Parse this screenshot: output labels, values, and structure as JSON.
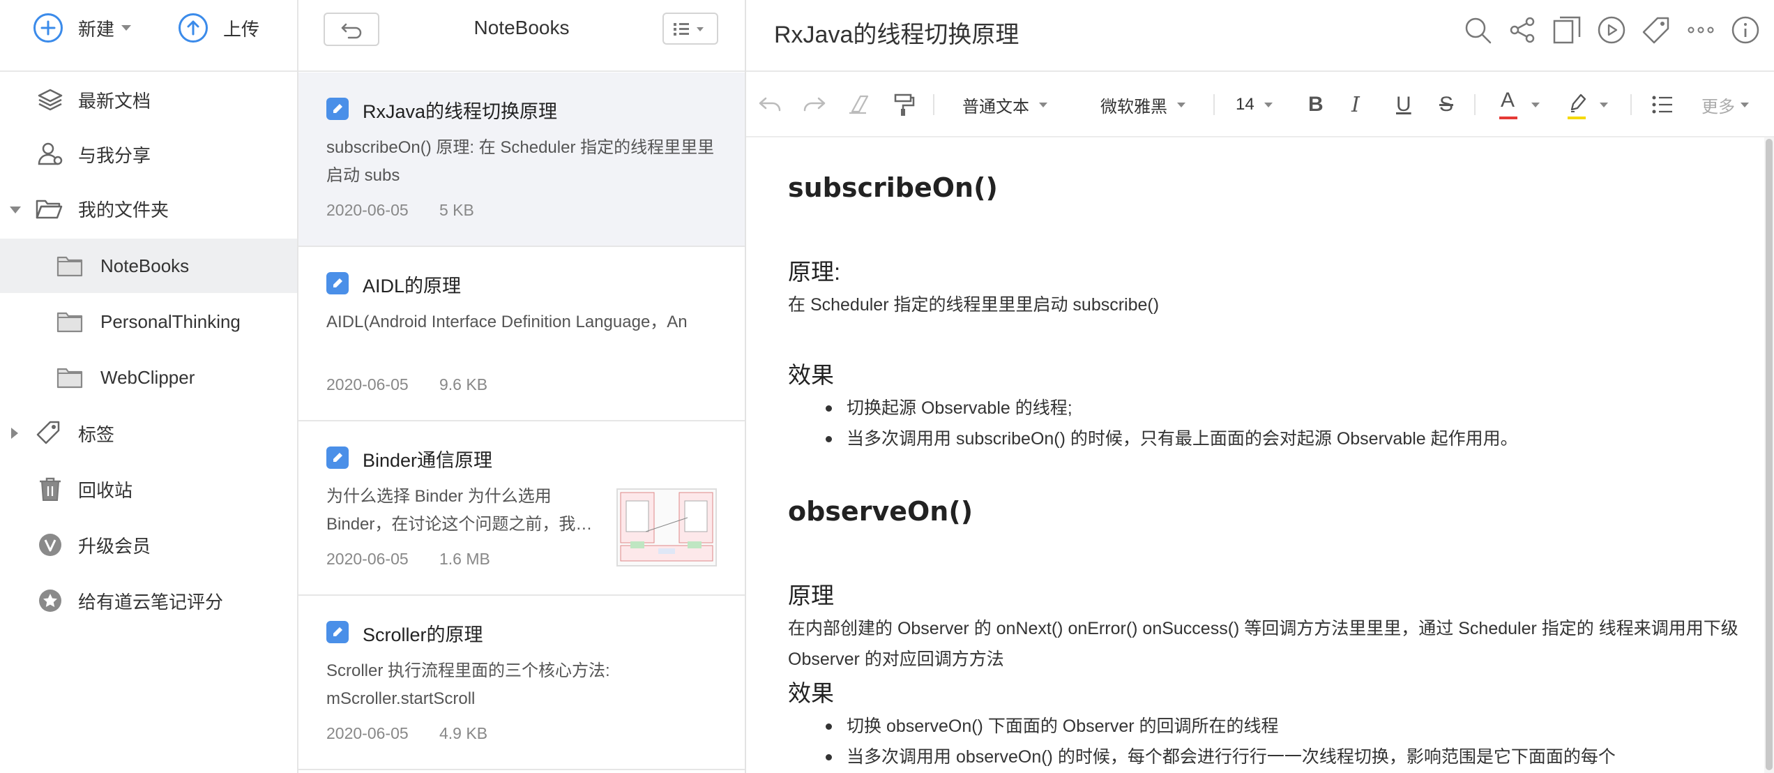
{
  "sidebar": {
    "new_label": "新建",
    "upload_label": "上传",
    "items": [
      {
        "label": "最新文档",
        "icon": "layers-icon"
      },
      {
        "label": "与我分享",
        "icon": "shared-user-icon"
      },
      {
        "label": "我的文件夹",
        "icon": "folder-open-icon"
      },
      {
        "label": "NoteBooks",
        "icon": "folder-icon"
      },
      {
        "label": "PersonalThinking",
        "icon": "folder-icon"
      },
      {
        "label": "WebClipper",
        "icon": "folder-icon"
      },
      {
        "label": "标签",
        "icon": "tag-icon"
      },
      {
        "label": "回收站",
        "icon": "trash-icon"
      },
      {
        "label": "升级会员",
        "icon": "vip-icon"
      },
      {
        "label": "给有道云笔记评分",
        "icon": "star-icon"
      }
    ]
  },
  "notelist": {
    "title": "NoteBooks",
    "notes": [
      {
        "title": "RxJava的线程切换原理",
        "summary": "subscribeOn() 原理: 在 Scheduler 指定的线程里里里启动 subs",
        "date": "2020-06-05",
        "size": "5 KB"
      },
      {
        "title": "AIDL的原理",
        "summary": "AIDL(Android Interface Definition Language，An",
        "date": "2020-06-05",
        "size": "9.6 KB"
      },
      {
        "title": "Binder通信原理",
        "summary": "为什么选择 Binder 为什么选用 Binder，在讨论这个问题之前，我…",
        "date": "2020-06-05",
        "size": "1.6 MB"
      },
      {
        "title": "Scroller的原理",
        "summary": "Scroller 执行流程里面的三个核心方法: mScroller.startScroll",
        "date": "2020-06-05",
        "size": "4.9 KB"
      }
    ]
  },
  "editor": {
    "title": "RxJava的线程切换原理",
    "toolbar": {
      "style_select": "普通文本",
      "font_select": "微软雅黑",
      "size_select": "14",
      "bold": "B",
      "italic": "I",
      "underline": "U",
      "strike": "S",
      "font_color": "A",
      "more": "更多"
    },
    "doc": {
      "h1_subscribe": "subscribeOn()",
      "h2_principle1": "原理:",
      "p_principle1": "在 Scheduler 指定的线程里里里启动 subscribe()",
      "h2_effect1": "效果",
      "effect1_items": [
        "切换起源 Observable 的线程;",
        "当多次调用用 subscribeOn() 的时候，只有最上面面的会对起源 Observable 起作用用。"
      ],
      "h1_observe": "observeOn()",
      "h2_principle2": "原理",
      "p_principle2": "在内部创建的 Observer 的 onNext() onError() onSuccess() 等回调方方法里里里，通过 Scheduler 指定的 线程来调用用下级 Observer 的对应回调方方法",
      "h2_effect2": "效果",
      "effect2_items": [
        "切换 observeOn() 下面面的 Observer 的回调所在的线程",
        "当多次调用用 observeOn() 的时候，每个都会进行行行一一次线程切换，影响范围是它下面面的每个"
      ]
    }
  },
  "colors": {
    "accent": "#3b8bea",
    "note_icon": "#4a8fe8",
    "font_color_bar": "#e53935",
    "highlight_bar": "#f5d90a"
  }
}
